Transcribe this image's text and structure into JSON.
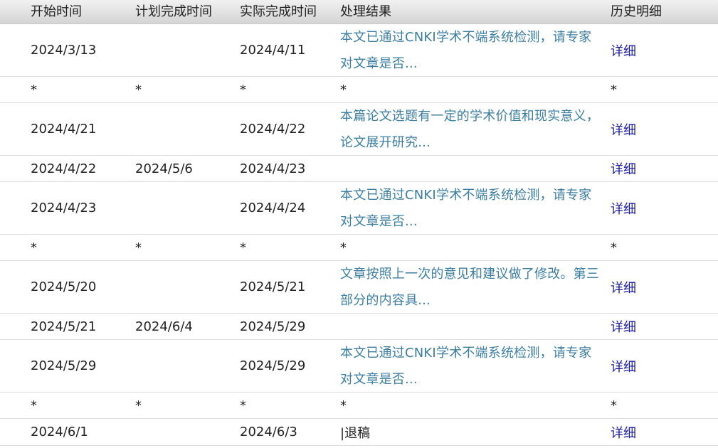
{
  "columns": {
    "start": "开始时间",
    "plan": "计划完成时间",
    "actual": "实际完成时间",
    "result": "处理结果",
    "history": "历史明细"
  },
  "rows": [
    {
      "start": "2024/3/13",
      "plan": "",
      "actual": "2024/4/11",
      "result": "本文已通过CNKI学术不端系统检测，请专家对文章是否...",
      "history": "详细"
    },
    {
      "start": "*",
      "plan": "*",
      "actual": "*",
      "result": "*",
      "history": "*"
    },
    {
      "start": "2024/4/21",
      "plan": "",
      "actual": "2024/4/22",
      "result": "本篇论文选题有一定的学术价值和现实意义，论文展开研究...",
      "history": "详细"
    },
    {
      "start": "2024/4/22",
      "plan": "2024/5/6",
      "actual": "2024/4/23",
      "result": "",
      "history": "详细"
    },
    {
      "start": "2024/4/23",
      "plan": "",
      "actual": "2024/4/24",
      "result": "本文已通过CNKI学术不端系统检测，请专家对文章是否...",
      "history": "详细"
    },
    {
      "start": "*",
      "plan": "*",
      "actual": "*",
      "result": "*",
      "history": "*"
    },
    {
      "start": "2024/5/20",
      "plan": "",
      "actual": "2024/5/21",
      "result": "文章按照上一次的意见和建议做了修改。第三部分的内容具...",
      "history": "详细"
    },
    {
      "start": "2024/5/21",
      "plan": "2024/6/4",
      "actual": "2024/5/29",
      "result": "",
      "history": "详细"
    },
    {
      "start": "2024/5/29",
      "plan": "",
      "actual": "2024/5/29",
      "result": "本文已通过CNKI学术不端系统检测，请专家对文章是否...",
      "history": "详细"
    },
    {
      "start": "*",
      "plan": "*",
      "actual": "*",
      "result": "*",
      "history": "*"
    },
    {
      "start": "2024/6/1",
      "plan": "",
      "actual": "2024/6/3",
      "result": "|退稿",
      "history": "详细"
    }
  ]
}
